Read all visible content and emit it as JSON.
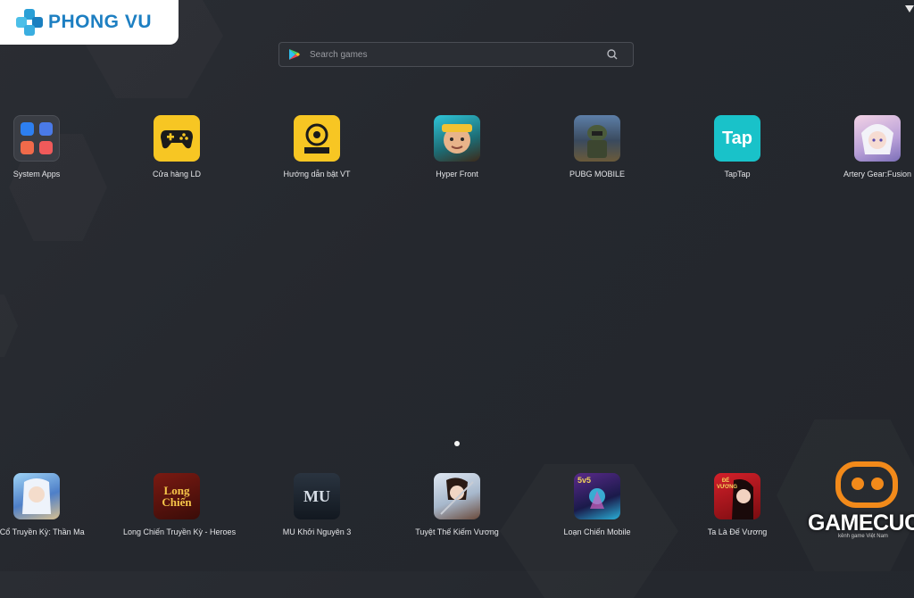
{
  "brand": {
    "logo_text": "PHONG VU",
    "color": "#1d7fc2"
  },
  "search": {
    "placeholder": "Search games",
    "icon": "search-icon",
    "store_icon": "play-store-icon"
  },
  "apps_top": [
    {
      "label": "System Apps",
      "icon": "system-apps-folder-icon"
    },
    {
      "label": "Cửa hàng LD",
      "icon": "gamepad-icon"
    },
    {
      "label": "Hướng dẫn bật VT",
      "icon": "novice-guidance-icon"
    },
    {
      "label": "Hyper Front",
      "icon": "hyper-front-icon"
    },
    {
      "label": "PUBG MOBILE",
      "icon": "pubg-icon"
    },
    {
      "label": "TapTap",
      "icon": "taptap-icon",
      "tile_text": "Tap"
    },
    {
      "label": "Artery Gear:Fusion",
      "icon": "artery-gear-icon"
    }
  ],
  "apps_bottom": [
    {
      "label": "ng Cổ Truyền Kỳ: Thần Ma",
      "icon": "than-ma-icon"
    },
    {
      "label": "Long Chiến Truyền Kỳ - Heroes",
      "icon": "long-chien-icon",
      "tile_text": "Long Chiến"
    },
    {
      "label": "MU Khởi Nguyên 3",
      "icon": "mu-icon",
      "tile_text": "MU"
    },
    {
      "label": "Tuyệt Thế Kiếm Vương",
      "icon": "kiem-vuong-icon"
    },
    {
      "label": "Loạn Chiến Mobile",
      "icon": "loan-chien-icon",
      "tile_text": "5v5"
    },
    {
      "label": "Ta Là Đế Vương",
      "icon": "de-vuong-icon",
      "tile_text": "ĐẾ VƯƠNG"
    }
  ],
  "watermark": {
    "text": "GAMECUC",
    "subtitle": "kênh game Việt Nam"
  }
}
